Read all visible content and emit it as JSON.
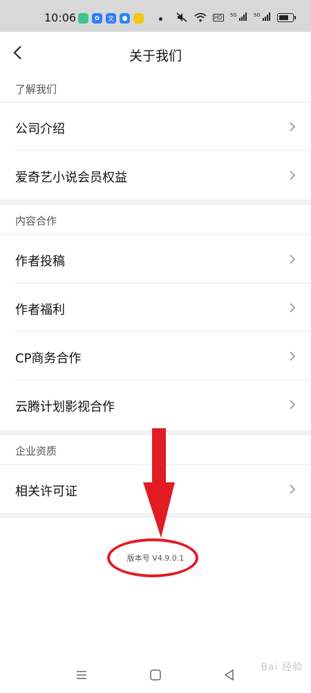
{
  "status_bar": {
    "time": "10:06",
    "app_icons": [
      {
        "name": "app-icon-green",
        "color": "#3cc48a",
        "glyph": ""
      },
      {
        "name": "app-icon-baidu-paw",
        "color": "#2f7cf6",
        "glyph": "✿"
      },
      {
        "name": "app-icon-assistant",
        "color": "#2e7cf6",
        "glyph": "文"
      },
      {
        "name": "app-icon-browser",
        "color": "#2a8bf2",
        "glyph": "●"
      },
      {
        "name": "app-icon-notes",
        "color": "#f5c518",
        "glyph": ""
      }
    ],
    "indicators": [
      "HD",
      "5G",
      "5G"
    ]
  },
  "header": {
    "title": "关于我们"
  },
  "sections": [
    {
      "title": "了解我们",
      "items": [
        "公司介绍",
        "爱奇艺小说会员权益"
      ]
    },
    {
      "title": "内容合作",
      "items": [
        "作者投稿",
        "作者福利",
        "CP商务合作",
        "云腾计划影视合作"
      ]
    },
    {
      "title": "企业资质",
      "items": [
        "相关许可证"
      ]
    }
  ],
  "version": "版本号 V4.9.0.1",
  "annotation": {
    "color": "#e21b23"
  },
  "watermark": "Bai 经验"
}
